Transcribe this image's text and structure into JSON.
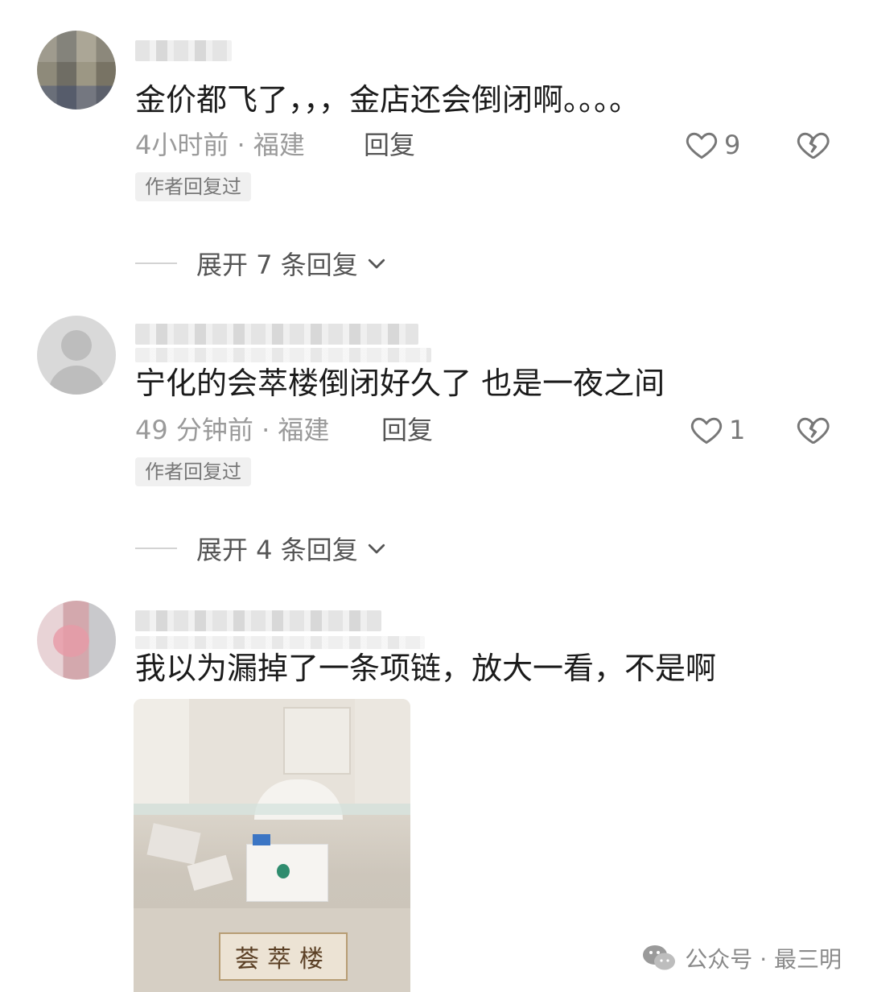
{
  "comments": [
    {
      "content": "金价都飞了，，，金店还会倒闭啊。。。。",
      "time_location": "4小时前 · 福建",
      "reply_label": "回复",
      "likes": "9",
      "tag": "作者回复过",
      "expand_label": "展开 7 条回复"
    },
    {
      "content": "宁化的会萃楼倒闭好久了 也是一夜之间",
      "time_location": "49 分钟前 · 福建",
      "reply_label": "回复",
      "likes": "1",
      "tag": "作者回复过",
      "expand_label": "展开 4 条回复"
    },
    {
      "content": "我以为漏掉了一条项链，放大一看，不是啊",
      "photo_sign": "荟萃楼"
    }
  ],
  "watermark": {
    "text": "公众号 · 最三明",
    "icon": "wechat-icon"
  },
  "icons": {
    "like": "heart-outline-icon",
    "dislike": "broken-heart-icon",
    "expand": "chevron-down-icon"
  }
}
